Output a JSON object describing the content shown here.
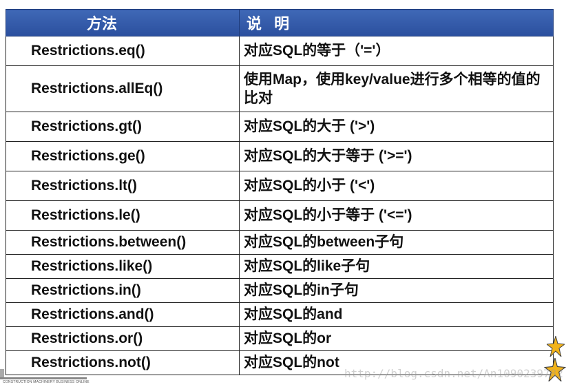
{
  "table": {
    "headers": {
      "method": "方法",
      "description": "说 明"
    },
    "rows": [
      {
        "method": "Restrictions.eq()",
        "description": "对应SQL的等于（'='）"
      },
      {
        "method": "Restrictions.allEq()",
        "description": "使用Map，使用key/value进行多个相等的值的比对"
      },
      {
        "method": "Restrictions.gt()",
        "description": "对应SQL的大于 ('>')"
      },
      {
        "method": "Restrictions.ge()",
        "description": "对应SQL的大于等于 ('>=')"
      },
      {
        "method": "Restrictions.lt()",
        "description": "对应SQL的小于 ('<')"
      },
      {
        "method": "Restrictions.le()",
        "description": "对应SQL的小于等于 ('<=')"
      },
      {
        "method": "Restrictions.between()",
        "description": "对应SQL的between子句"
      },
      {
        "method": "Restrictions.like()",
        "description": "对应SQL的like子句"
      },
      {
        "method": "Restrictions.in()",
        "description": "对应SQL的in子句"
      },
      {
        "method": "Restrictions.and()",
        "description": "对应SQL的and"
      },
      {
        "method": "Restrictions.or()",
        "description": "对应SQL的or"
      },
      {
        "method": "Restrictions.not()",
        "description": "对应SQL的not"
      }
    ]
  },
  "footer": {
    "logo_text": "CONSTRUCTION MACHINERY BUSINESS ONLINE",
    "watermark": "http://blog.csdn.net/An1090239782"
  },
  "colors": {
    "header_bg": "#2f56a6",
    "header_text": "#ffffff",
    "star": "#f2b31a"
  }
}
